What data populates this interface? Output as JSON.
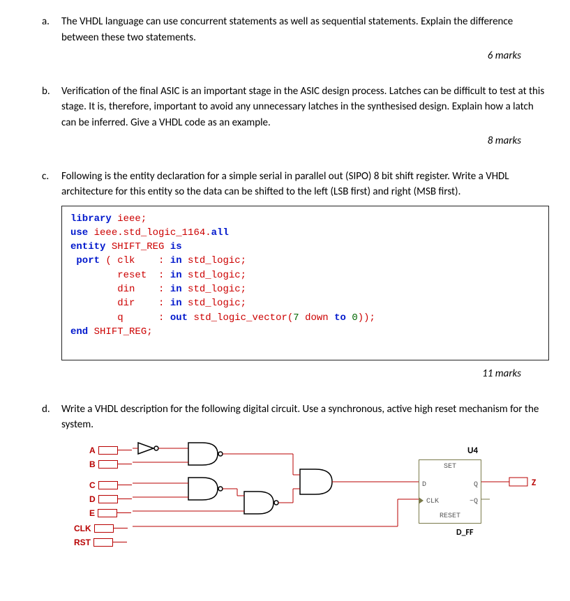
{
  "a": {
    "label": "a.",
    "text": "The VHDL language can use concurrent statements as well as sequential statements. Explain the difference between these two statements.",
    "marks": "6 marks"
  },
  "b": {
    "label": "b.",
    "text": "Verification of the final ASIC is an important stage in the ASIC design process. Latches can be difficult to test at this stage. It is, therefore, important to avoid any unnecessary latches in the synthesised design. Explain how a latch can be inferred. Give a VHDL code as an example.",
    "marks": "8 marks"
  },
  "c": {
    "label": "c.",
    "text": "Following is the entity declaration for a simple serial in parallel out (SIPO) 8 bit shift register. Write a VHDL architecture for this entity so the data can be shifted to the left (LSB first) and right (MSB first).",
    "code": {
      "l1a": "library",
      "l1b": " ieee;",
      "l2a": "use",
      "l2b": " ieee.",
      "l2c": "std_logic_1164",
      "l2d": ".",
      "l2e": "all",
      "l3a": "entity",
      "l3b": " SHIFT_REG ",
      "l3c": "is",
      "l4a": " port",
      "l4b": " ( clk    : ",
      "l4c": "in",
      "l4d": " std_logic;",
      "l5a": "        reset  : ",
      "l5b": "in",
      "l5c": " std_logic;",
      "l6a": "        din    : ",
      "l6b": "in",
      "l6c": " std_logic;",
      "l7a": "        dir    : ",
      "l7b": "in",
      "l7c": " std_logic;",
      "l8a": "        q      : ",
      "l8b": "out",
      "l8c": " std_logic_vector(",
      "l8d": "7",
      "l8e": " down ",
      "l8f": "to",
      "l8g": " ",
      "l8h": "0",
      "l8i": "));",
      "l9a": "end",
      "l9b": " SHIFT_REG;"
    },
    "marks": "11 marks"
  },
  "d": {
    "label": "d.",
    "text": "Write a VHDL description for the following digital circuit. Use a synchronous, active high reset mechanism for the system.",
    "pins": {
      "A": "A",
      "B": "B",
      "C": "C",
      "D": "D",
      "E": "E",
      "CLK": "CLK",
      "RST": "RST"
    },
    "ff": {
      "set": "SET",
      "reset": "RESET",
      "d": "D",
      "q": "Q",
      "nq": "~Q",
      "clk": "CLK"
    },
    "u4": "U4",
    "dff": "D_FF",
    "z": "Z"
  }
}
